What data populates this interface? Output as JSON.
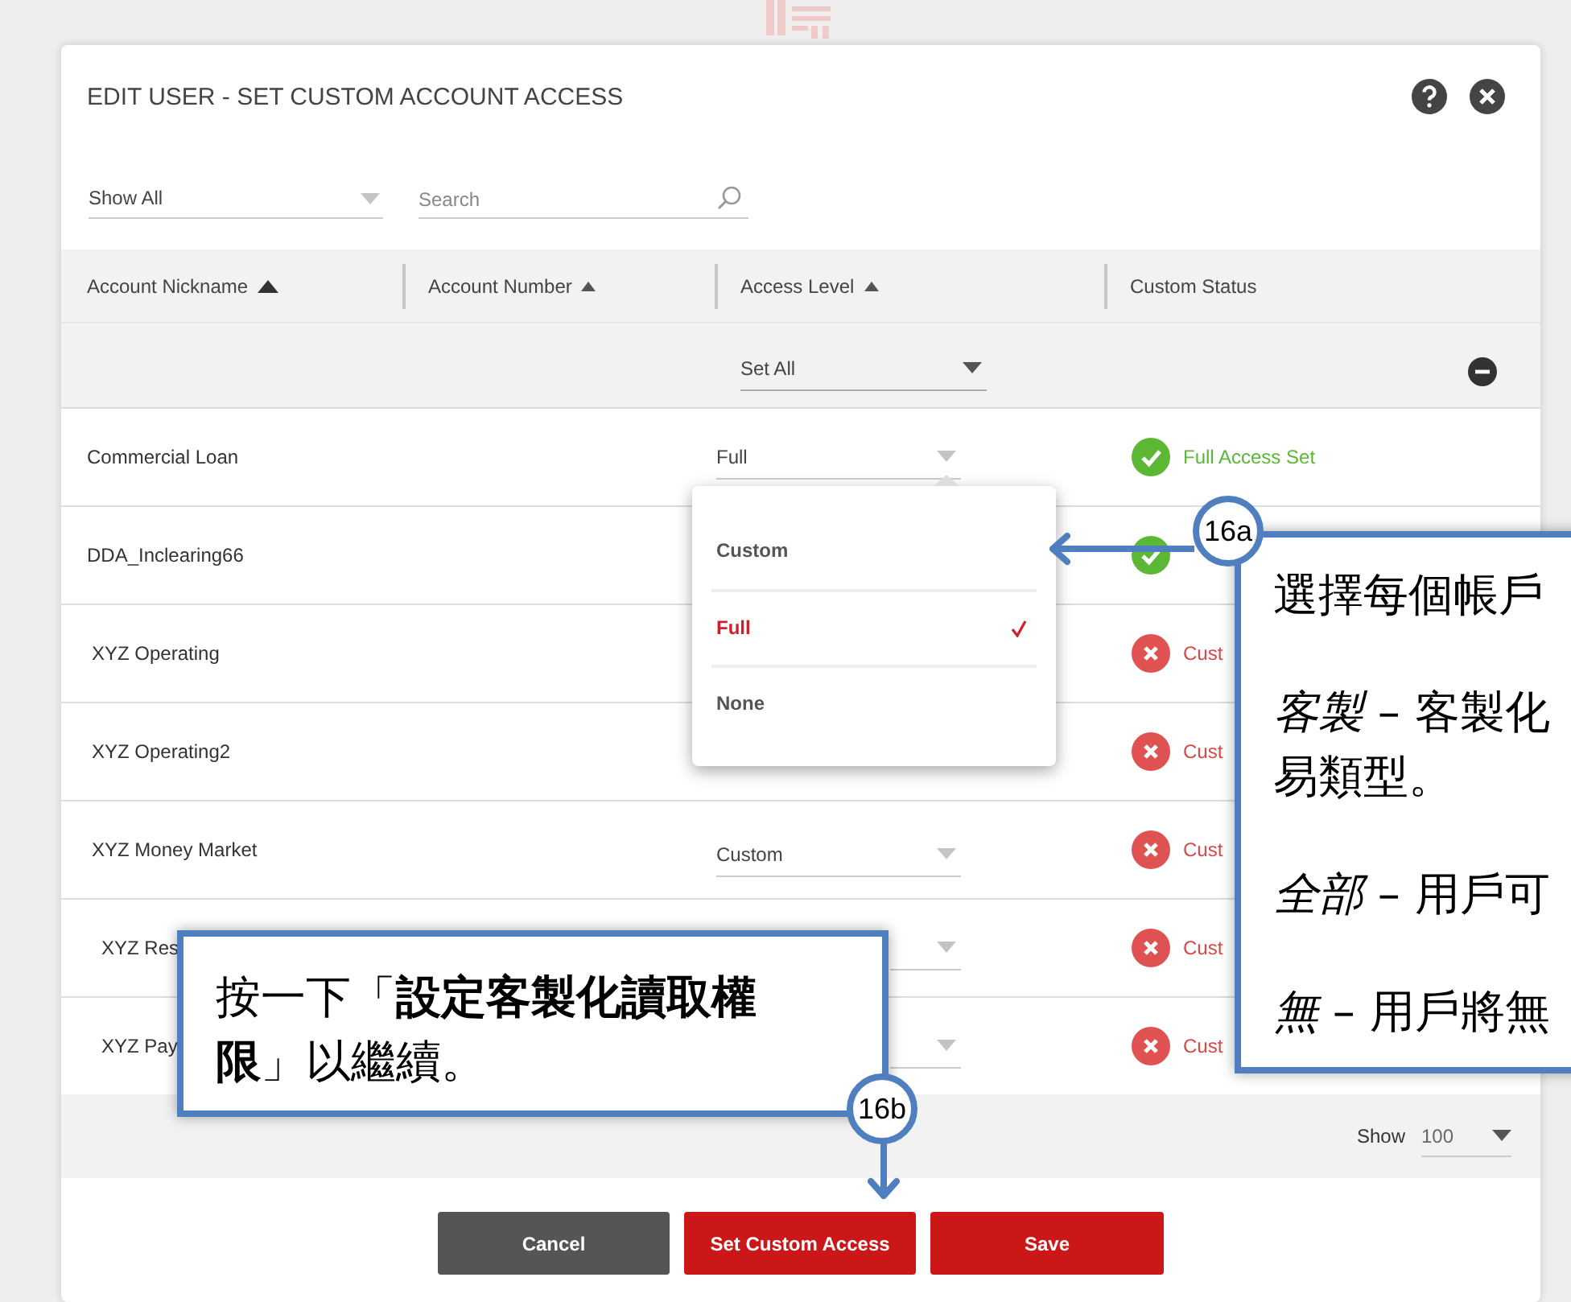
{
  "dialog": {
    "title": "EDIT USER - SET CUSTOM ACCOUNT ACCESS",
    "filter": {
      "value": "Show All"
    },
    "search": {
      "placeholder": "Search"
    },
    "columns": [
      {
        "label": "Account Nickname",
        "kind": "sortable",
        "selected": true
      },
      {
        "label": "Account Number",
        "kind": "sortable",
        "selected": false
      },
      {
        "label": "Access Level",
        "kind": "sortable",
        "selected": false
      },
      {
        "label": "Custom Status",
        "kind": "plain"
      }
    ],
    "set_all": {
      "value": "Set All"
    },
    "rows": [
      {
        "nickname": "Commercial Loan",
        "access": "Full",
        "dropdown": true,
        "status": {
          "kind": "full",
          "text": "Full Access Set"
        }
      },
      {
        "nickname": "DDA_Inclearing66",
        "dropdown": false,
        "status": {
          "kind": "full"
        }
      },
      {
        "nickname": "XYZ Operating",
        "dropdown": false,
        "status": {
          "kind": "custom",
          "text": "Cust"
        }
      },
      {
        "nickname": "XYZ Operating2",
        "dropdown": false,
        "status": {
          "kind": "custom",
          "text": "Cust"
        }
      },
      {
        "nickname": "XYZ Money Market",
        "access": "Custom",
        "dropdown": true,
        "status": {
          "kind": "custom",
          "text": "Cust"
        }
      },
      {
        "nickname": "XYZ Res",
        "dropdown": true,
        "status": {
          "kind": "custom",
          "text": "Cust"
        }
      },
      {
        "nickname": "XYZ Pay",
        "dropdown": true,
        "status": {
          "kind": "custom",
          "text": "Cust"
        }
      }
    ],
    "access_menu": [
      {
        "label": "Custom",
        "selected": false
      },
      {
        "label": "Full",
        "selected": true
      },
      {
        "label": "None",
        "selected": false
      }
    ],
    "footer": {
      "show_label": "Show",
      "page_size": "100"
    },
    "buttons": [
      {
        "label": "Cancel",
        "kind": "secondary"
      },
      {
        "label": "Set Custom Access",
        "kind": "primary"
      },
      {
        "label": "Save",
        "kind": "primary"
      }
    ]
  },
  "callouts": [
    {
      "step": "16a",
      "paragraphs": [
        [
          "選擇每個帳戶"
        ],
        [
          "*客製* – 客製化",
          "易類型。"
        ],
        [
          "*全部* – 用戶可"
        ],
        [
          "*無* – 用戶將無"
        ]
      ]
    },
    {
      "step": "16b",
      "paragraphs": [
        [
          "按一下「**設定客製化讀取權限**」以繼續。"
        ]
      ]
    }
  ]
}
